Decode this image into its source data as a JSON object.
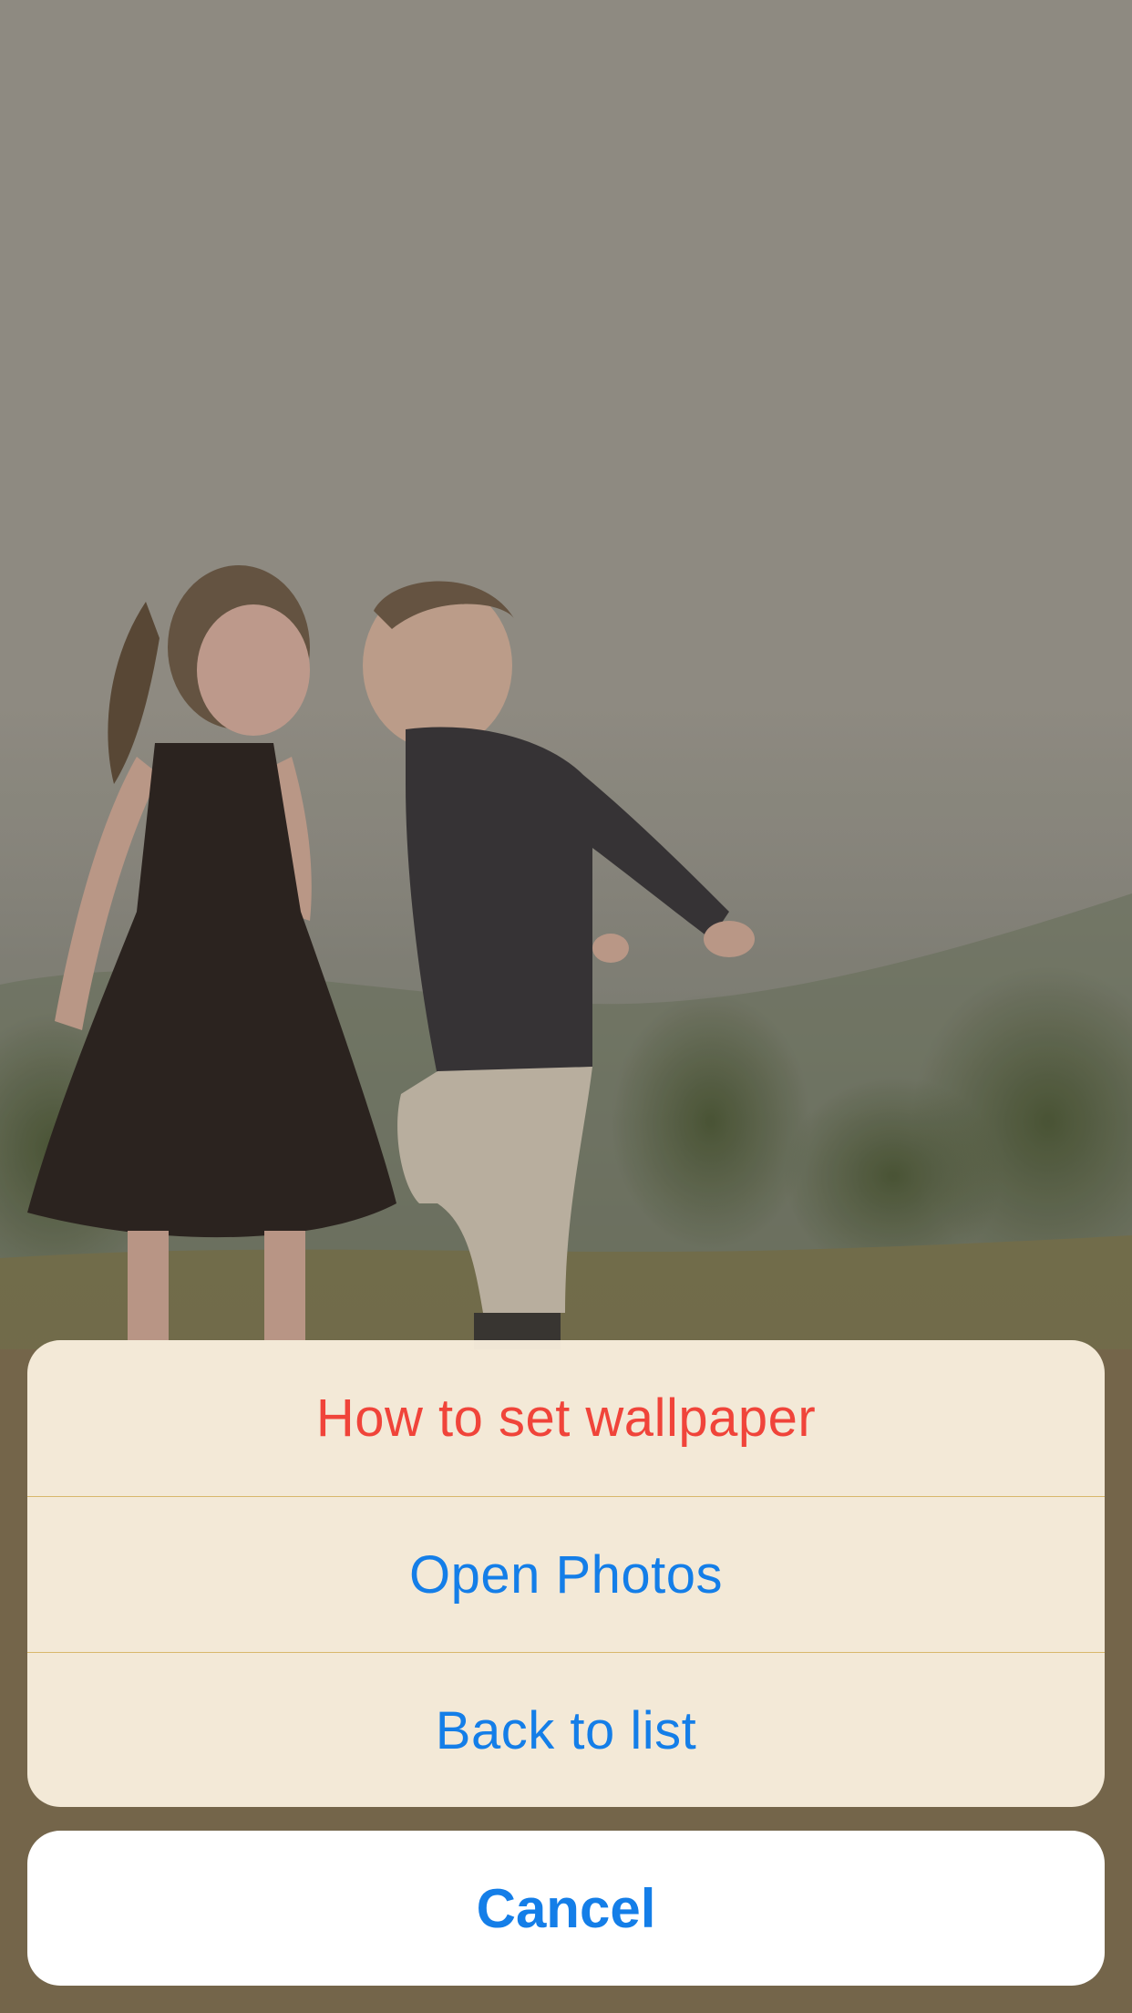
{
  "wallpaper": {
    "description_icon": "wallpaper-photo"
  },
  "action_sheet": {
    "items": [
      {
        "label": "How to set wallpaper",
        "style": "destructive",
        "color": "#f0443a"
      },
      {
        "label": "Open Photos",
        "style": "default",
        "color": "#147ee8"
      },
      {
        "label": "Back to list",
        "style": "default",
        "color": "#147ee8"
      }
    ],
    "cancel_label": "Cancel",
    "accent_color": "#147ee8"
  }
}
